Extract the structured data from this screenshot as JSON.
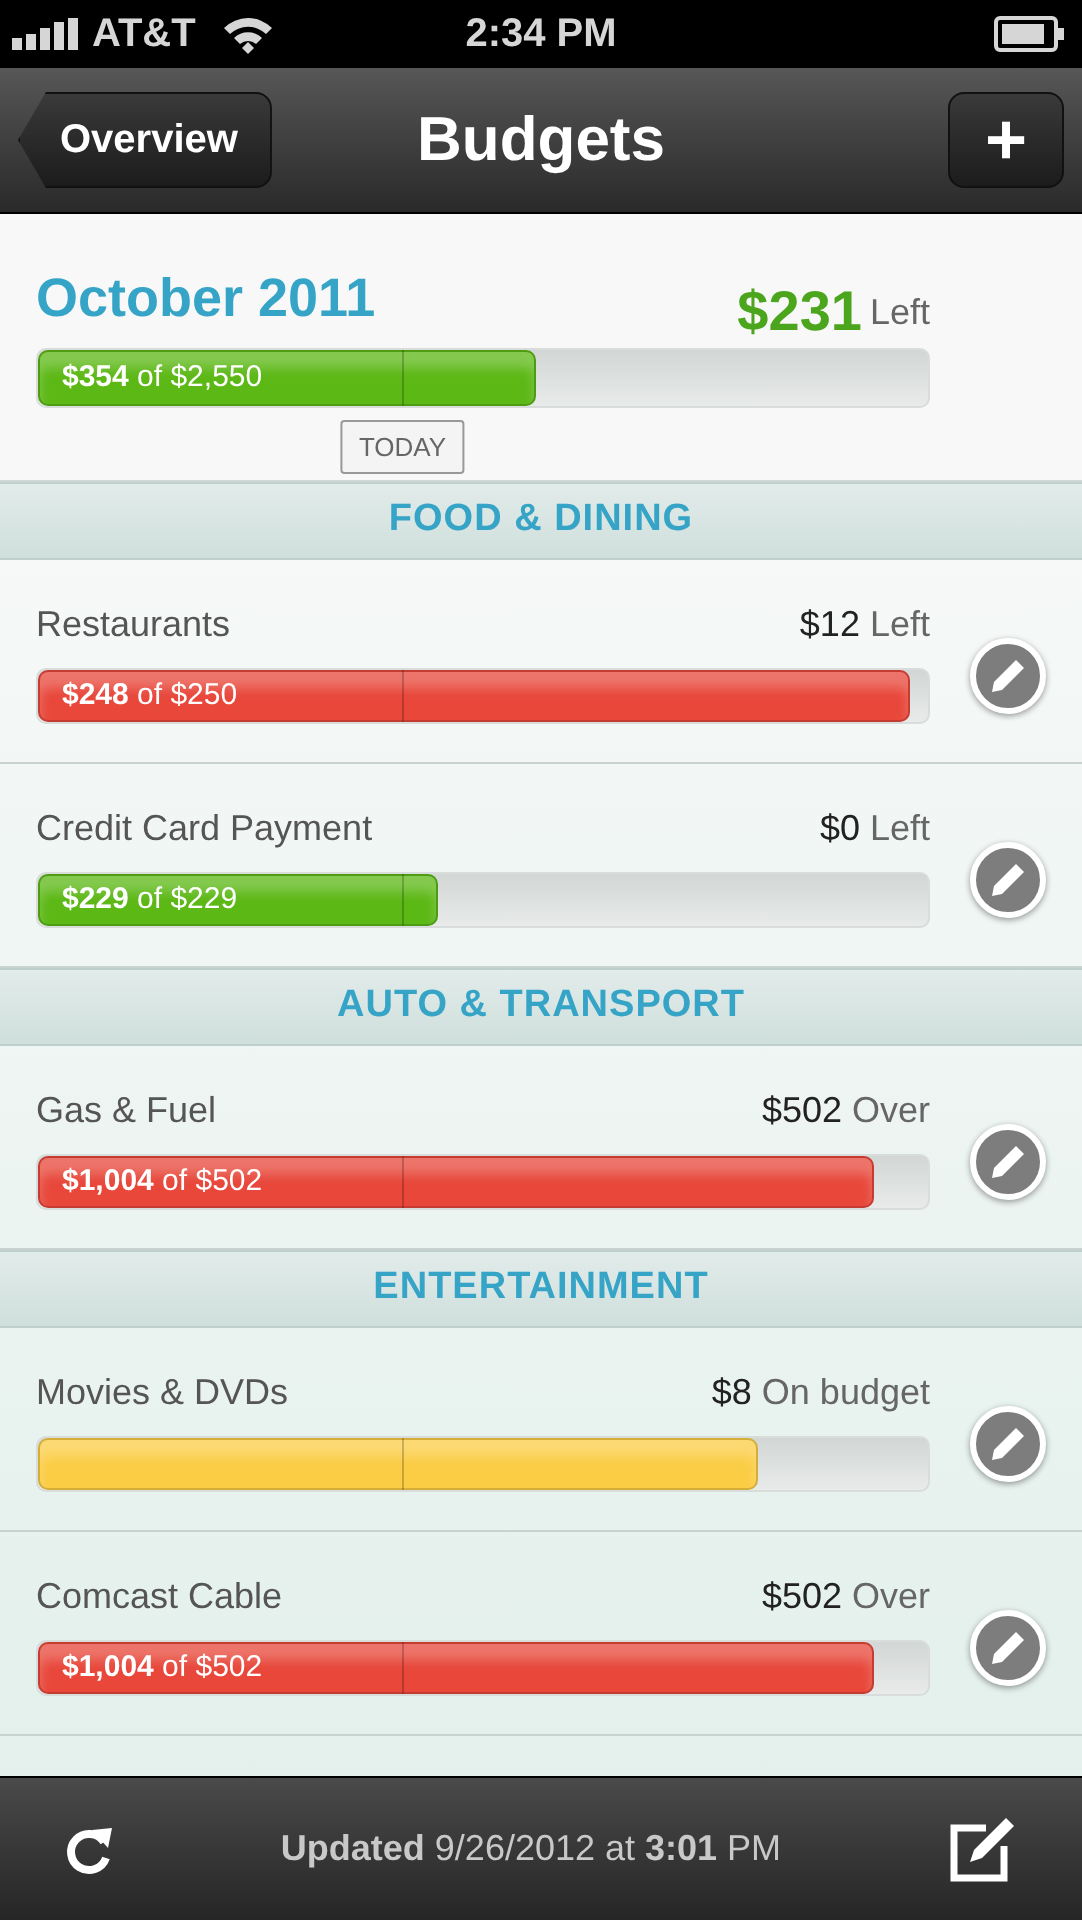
{
  "status_bar": {
    "carrier": "AT&T",
    "time": "2:34 PM"
  },
  "nav": {
    "back": "Overview",
    "title": "Budgets",
    "add": "+"
  },
  "summary": {
    "month": "October 2011",
    "amount": "$231",
    "amount_label": "Left",
    "bar": {
      "label": "**$354** of $2,550",
      "color": "#5cb815",
      "level": 0.56
    },
    "today": {
      "label": "TODAY",
      "level": 0.41
    }
  },
  "sections": [
    {
      "title": "FOOD & DINING",
      "items": [
        {
          "name": "Restaurants",
          "amount": "$12",
          "note": "Left",
          "bar": {
            "label": "**$248** of $250",
            "color": "#e8473a",
            "level": 0.98
          }
        },
        {
          "name": "Credit Card Payment",
          "amount": "$0",
          "note": "Left",
          "bar": {
            "label": "**$229** of $229",
            "color": "#5cb815",
            "level": 0.45
          }
        }
      ]
    },
    {
      "title": "AUTO & TRANSPORT",
      "items": [
        {
          "name": "Gas & Fuel",
          "amount": "$502",
          "note": "Over",
          "bar": {
            "label": "**$1,004** of $502",
            "color": "#e8473a",
            "level": 0.94
          }
        }
      ]
    },
    {
      "title": "ENTERTAINMENT",
      "items": [
        {
          "name": "Movies & DVDs",
          "amount": "$8",
          "note": "On budget",
          "bar": {
            "color": "#fbcd45",
            "level": 0.81
          }
        },
        {
          "name": "Comcast Cable",
          "amount": "$502",
          "note": "Over",
          "bar": {
            "label": "**$1,004** of $502",
            "color": "#e8473a",
            "level": 0.94
          }
        }
      ]
    }
  ],
  "footer": {
    "updated": "**Updated** 9/26/2012 at **3:01** PM"
  }
}
